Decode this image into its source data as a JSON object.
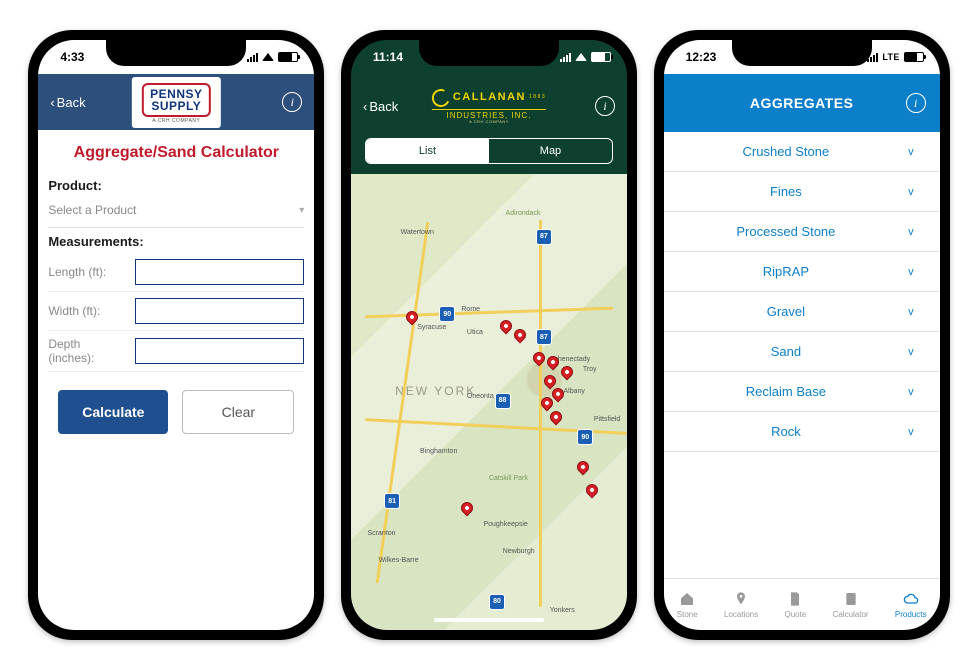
{
  "phone1": {
    "status_time": "4:33",
    "back": "Back",
    "brand_line1": "PENNSY",
    "brand_line2": "SUPPLY",
    "brand_sub": "A CRH COMPANY",
    "title": "Aggregate/Sand Calculator",
    "product_label": "Product:",
    "product_placeholder": "Select a Product",
    "measurements_label": "Measurements:",
    "length_label": "Length (ft):",
    "width_label": "Width (ft):",
    "depth_label": "Depth (inches):",
    "length_value": "",
    "width_value": "",
    "depth_value": "",
    "calculate": "Calculate",
    "clear": "Clear"
  },
  "phone2": {
    "status_time": "11:14",
    "back": "Back",
    "logo_top": "CALLANAN",
    "logo_year": "1883",
    "logo_mid": "INDUSTRIES, INC.",
    "logo_sub": "A CRH COMPANY",
    "tab_list": "List",
    "tab_map": "Map",
    "state_label": "NEW YORK",
    "cities": [
      "Watertown",
      "Syracuse",
      "Utica",
      "Rome",
      "Binghamton",
      "Schenectady",
      "Albany",
      "Troy",
      "Pittsfield",
      "Scranton",
      "Wilkes-Barre",
      "Poughkeepsie",
      "Newburgh",
      "Yonkers",
      "Catskill Park",
      "Adirondack",
      "Oneonta"
    ],
    "shields": [
      "87",
      "87",
      "88",
      "90",
      "81",
      "80",
      "90"
    ]
  },
  "phone3": {
    "status_time": "12:23",
    "network": "LTE",
    "title": "AGGREGATES",
    "items": [
      "Crushed Stone",
      "Fines",
      "Processed Stone",
      "RipRAP",
      "Gravel",
      "Sand",
      "Reclaim Base",
      "Rock"
    ],
    "tabs": [
      "Stone",
      "Locations",
      "Quote",
      "Calculator",
      "Products"
    ],
    "active_tab": 4
  }
}
